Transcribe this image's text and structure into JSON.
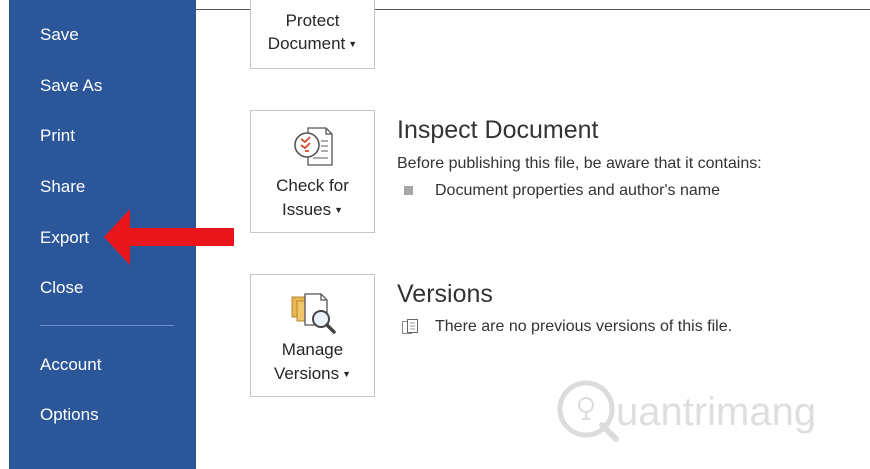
{
  "sidebar": {
    "items": [
      {
        "label": "Save"
      },
      {
        "label": "Save As"
      },
      {
        "label": "Print"
      },
      {
        "label": "Share"
      },
      {
        "label": "Export"
      },
      {
        "label": "Close"
      },
      {
        "label": "Account"
      },
      {
        "label": "Options"
      }
    ]
  },
  "tiles": {
    "protect": {
      "line1": "Protect",
      "line2": "Document"
    },
    "check": {
      "line1": "Check for",
      "line2": "Issues"
    },
    "manage": {
      "line1": "Manage",
      "line2": "Versions"
    }
  },
  "inspect": {
    "title": "Inspect Document",
    "description": "Before publishing this file, be aware that it contains:",
    "bullet": "Document properties and author's name"
  },
  "versions": {
    "title": "Versions",
    "text": "There are no previous versions of this file."
  },
  "watermark": {
    "text": "uantrimang"
  },
  "colors": {
    "sidebar": "#2b579a",
    "arrow": "#e8161b"
  },
  "icons": {
    "arrow": "red-left-arrow",
    "check": "inspect-document-icon",
    "manage": "manage-versions-icon",
    "bullet": "bullet-square-icon",
    "versions": "document-pages-icon"
  }
}
